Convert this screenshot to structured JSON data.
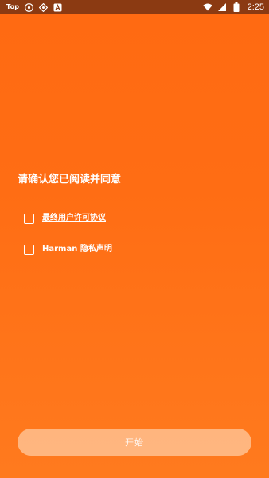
{
  "status_bar": {
    "left_text": "Top",
    "icons_left": [
      "app-icon-1",
      "app-icon-2",
      "font-icon"
    ],
    "icons_right": [
      "wifi-icon",
      "signal-icon",
      "battery-icon"
    ],
    "time": "2:25"
  },
  "main": {
    "title": "请确认您已阅读并同意",
    "agreements": [
      {
        "label": "最终用户许可协议",
        "checked": false
      },
      {
        "label": "Harman 隐私声明",
        "checked": false
      }
    ],
    "start_button_label": "开始"
  },
  "colors": {
    "background_top": "#ff6a12",
    "background_bottom": "#ff7a1e",
    "status_bar": "#8b3a12",
    "button_fill": "#ffcda5"
  }
}
